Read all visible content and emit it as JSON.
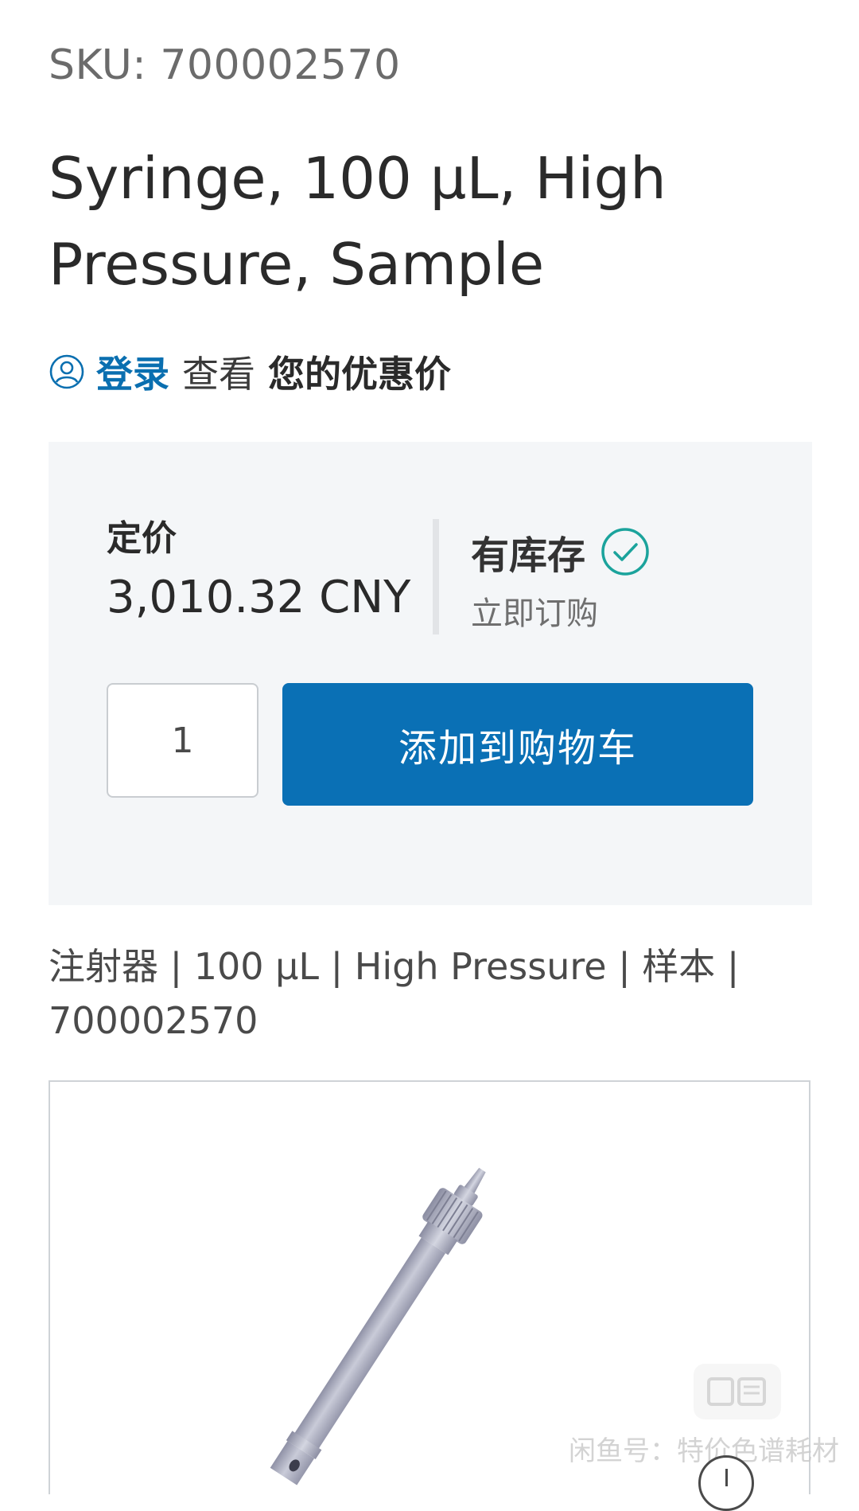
{
  "product": {
    "sku": "SKU: 700002570",
    "title": "Syringe, 100 µL, High Pressure, Sample"
  },
  "login_prompt": {
    "icon": "user-circle-icon",
    "link_label": "登录",
    "middle_text": "查看",
    "strong_text": "您的优惠价"
  },
  "pricing": {
    "label": "定价",
    "value": "3,010.32 CNY"
  },
  "stock": {
    "label": "有库存",
    "icon": "check-circle-icon",
    "sublabel": "立即订购"
  },
  "purchase": {
    "quantity": "1",
    "add_to_cart_label": "添加到购物车"
  },
  "description": "注射器 | 100 µL | High Pressure | 样本 | 700002570",
  "gallery": {
    "zoom_icon": "zoom-in-icon"
  },
  "watermark": {
    "text": "闲鱼号：特价色谱耗材",
    "badge_icon": "xianyu-logo-icon"
  },
  "colors": {
    "brand_blue": "#0a70b5",
    "link_blue": "#0a6fb0",
    "stock_teal": "#1ba39c",
    "panel_bg": "#f4f6f8"
  }
}
